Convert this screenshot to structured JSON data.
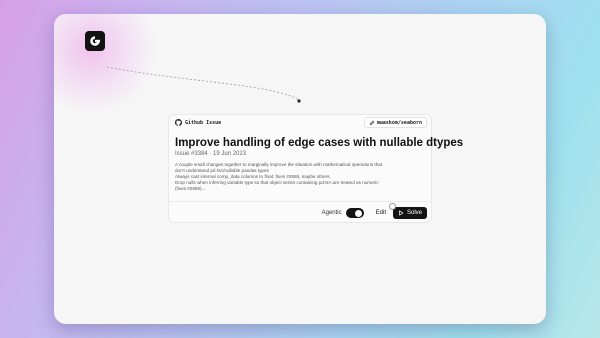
{
  "issue_card": {
    "source_label": "Github Issue",
    "repo": "mwaskom/seaborn",
    "title": "Improve handling of edge cases with nullable dtypes",
    "meta": "Issue #3384 · 19 Jun 2023",
    "body_lines": [
      "A couple small changes together to marginally improve the situation with mathematical operations that",
      "don't understand pd.NA/nullable pandas types",
      "Always cast internal comp_data columns to float; fixes #2888, maybe others.",
      "Drop nulls when inferring variable type so that object series containing pd.NA are treated as numeric",
      "(fixes #2686)..."
    ]
  },
  "actions": {
    "agentic_label": "Agentic",
    "agentic_on": true,
    "edit_label": "Edit",
    "solve_label": "Solve"
  },
  "icons": {
    "logo": "app-logo-icon",
    "source": "github-icon",
    "repo": "link-icon",
    "solve": "play-icon"
  },
  "colors": {
    "primary_button": "#141414",
    "card_background": "#f6f6f7"
  }
}
